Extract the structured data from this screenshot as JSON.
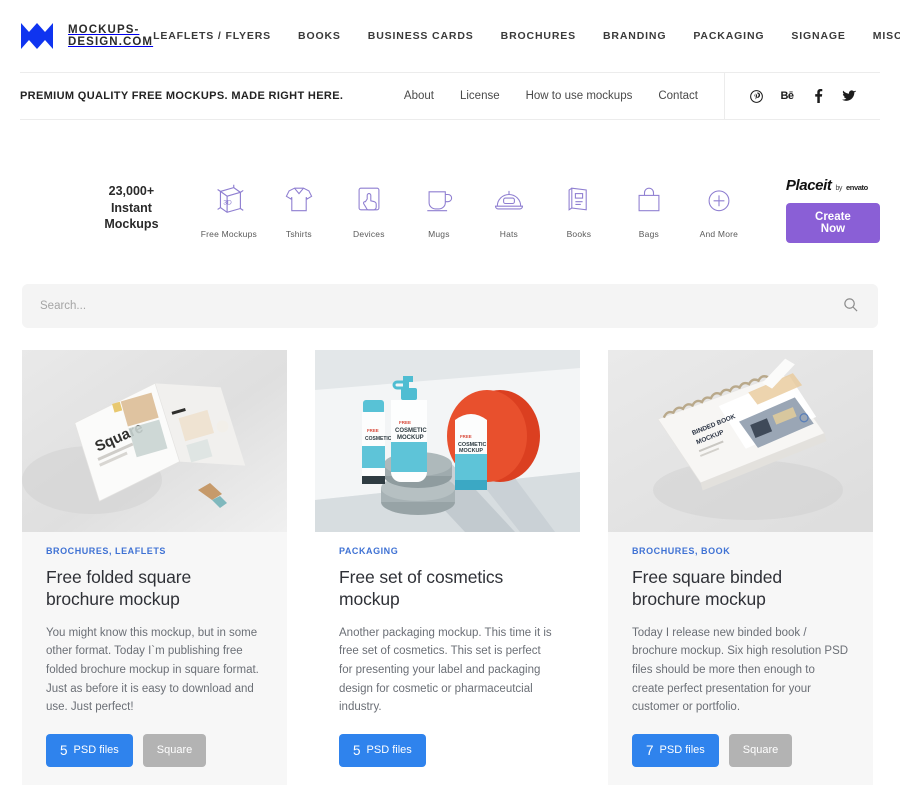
{
  "brand": {
    "name": "MOCKUPS-DESIGN.COM",
    "logo_icon": "m-logo-icon",
    "logo_color": "#0f34f0"
  },
  "main_nav": [
    {
      "label": "LEAFLETS / FLYERS"
    },
    {
      "label": "BOOKS"
    },
    {
      "label": "BUSINESS CARDS"
    },
    {
      "label": "BROCHURES"
    },
    {
      "label": "BRANDING"
    },
    {
      "label": "PACKAGING"
    },
    {
      "label": "SIGNAGE"
    },
    {
      "label": "MISC"
    }
  ],
  "subnav": {
    "tagline": "PREMIUM QUALITY FREE MOCKUPS. MADE RIGHT HERE.",
    "links": [
      {
        "label": "About"
      },
      {
        "label": "License"
      },
      {
        "label": "How to use mockups"
      },
      {
        "label": "Contact"
      }
    ],
    "social": [
      {
        "name": "pinterest-icon",
        "glyph": "Ⓟ"
      },
      {
        "name": "behance-icon",
        "glyph": "Bē"
      },
      {
        "name": "facebook-icon",
        "glyph": "f"
      },
      {
        "name": "twitter-icon",
        "glyph": "ᴠ"
      }
    ]
  },
  "promo": {
    "count_line1": "23,000+",
    "count_line2": "Instant",
    "count_line3": "Mockups",
    "categories": [
      {
        "label": "Free Mockups",
        "icon": "cube-3d-icon"
      },
      {
        "label": "Tshirts",
        "icon": "tshirt-icon"
      },
      {
        "label": "Devices",
        "icon": "device-tap-icon"
      },
      {
        "label": "Mugs",
        "icon": "mug-icon"
      },
      {
        "label": "Hats",
        "icon": "cap-icon"
      },
      {
        "label": "Books",
        "icon": "book-icon"
      },
      {
        "label": "Bags",
        "icon": "shopping-bag-icon"
      },
      {
        "label": "And More",
        "icon": "plus-circle-icon"
      }
    ],
    "placeit_name": "Placeit",
    "placeit_by": "by",
    "placeit_envato": "envato",
    "cta_label": "Create Now",
    "cta_color": "#8a5fd6",
    "accent_purple": "#8f7fd1"
  },
  "search": {
    "placeholder": "Search...",
    "value": "",
    "icon": "search-icon"
  },
  "cards": [
    {
      "tags": "BROCHURES, LEAFLETS",
      "title": "Free folded square brochure mockup",
      "text": "You might know this mockup, but in some other format. Today I`m publishing free folded brochure mockup in square format. Just as before it is easy to download and use. Just perfect!",
      "psd_count": "5",
      "psd_label": "PSD files",
      "format_label": "Square",
      "thumb_alt": "folded-square-brochure-mockup-photo",
      "has_format_badge": true
    },
    {
      "tags": "PACKAGING",
      "title": "Free set of cosmetics mockup",
      "text": "Another packaging mockup. This time it is free set of cosmetics. This set is perfect for presenting your label and packaging design for cosmetic or pharmaceutcial industry.",
      "psd_count": "5",
      "psd_label": "PSD files",
      "format_label": "",
      "thumb_alt": "cosmetics-bottles-mockup-photo",
      "has_format_badge": false
    },
    {
      "tags": "BROCHURES, BOOK",
      "title": "Free square binded brochure mockup",
      "text": "Today I release new binded book / brochure mockup. Six high resolution PSD files should be more then enough to create perfect presentation for your customer or portfolio.",
      "psd_count": "7",
      "psd_label": "PSD files",
      "format_label": "Square",
      "thumb_alt": "square-binded-brochure-mockup-photo",
      "has_format_badge": true
    }
  ],
  "colors": {
    "link_blue": "#3f72d4",
    "badge_blue": "#2f83ed",
    "badge_gray": "#b3b3b3",
    "card_bg": "#f7f7f7",
    "search_bg": "#f4f4f4"
  }
}
